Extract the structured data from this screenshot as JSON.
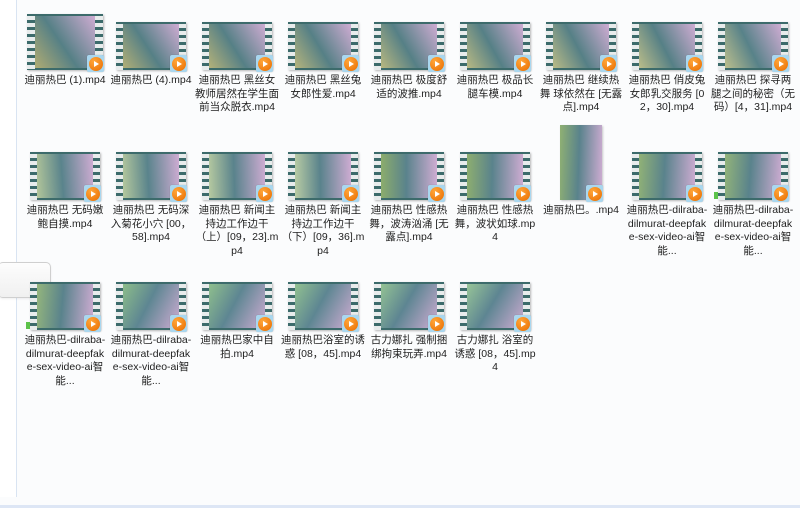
{
  "window": {
    "background_color": "#fbfcfd",
    "border_color": "#dde6f5",
    "view_mode": "Large icons thumbnail grid"
  },
  "left_rail": {
    "handle_label": ""
  },
  "icons": {
    "play_badge": "play-icon",
    "overlay_badge": "video-overlay-icon"
  },
  "colors": {
    "filmstrip": "#3c6b6b",
    "play_badge_bg": "#a9d7ef",
    "play_disc": "#f07d10",
    "label_text": "#1f1f1f",
    "sync_dot": "#5cc24a"
  },
  "grid": {
    "columns": 9,
    "rows": 3,
    "total_items": 24,
    "items": [
      {
        "name": "迪丽热巴 (1).mp4",
        "type": "video",
        "thumb_style": "filmstrip-large",
        "row": 1,
        "col": 1,
        "img": "thumb-01"
      },
      {
        "name": "迪丽热巴 (4).mp4",
        "type": "video",
        "thumb_style": "filmstrip",
        "row": 1,
        "col": 2,
        "img": "thumb-02"
      },
      {
        "name": "迪丽热巴 黑丝女教师居然在学生面前当众脱衣.mp4",
        "type": "video",
        "thumb_style": "filmstrip",
        "row": 1,
        "col": 3,
        "img": "thumb-03"
      },
      {
        "name": "迪丽热巴 黑丝兔女郎性爱.mp4",
        "type": "video",
        "thumb_style": "filmstrip",
        "row": 1,
        "col": 4,
        "img": "thumb-04"
      },
      {
        "name": "迪丽热巴 极度舒适的波推.mp4",
        "type": "video",
        "thumb_style": "filmstrip",
        "row": 1,
        "col": 5,
        "img": "thumb-05"
      },
      {
        "name": "迪丽热巴 极品长腿车模.mp4",
        "type": "video",
        "thumb_style": "filmstrip",
        "row": 1,
        "col": 6,
        "img": "thumb-06"
      },
      {
        "name": "迪丽热巴 继续热舞 球依然在 [无露点].mp4",
        "type": "video",
        "thumb_style": "filmstrip",
        "row": 1,
        "col": 7,
        "img": "thumb-07"
      },
      {
        "name": "迪丽热巴 俏皮兔女郎乳交服务 [02，30].mp4",
        "type": "video",
        "thumb_style": "filmstrip",
        "row": 1,
        "col": 8,
        "img": "thumb-08"
      },
      {
        "name": "迪丽热巴 探寻两腿之间的秘密（无码）[4，31].mp4",
        "type": "video",
        "thumb_style": "filmstrip",
        "row": 1,
        "col": 9,
        "img": "thumb-09"
      },
      {
        "name": "迪丽热巴 无码嫩鲍自摸.mp4",
        "type": "video",
        "thumb_style": "filmstrip",
        "row": 2,
        "col": 1,
        "img": "thumb-10"
      },
      {
        "name": "迪丽热巴 无码深入菊花小穴 [00，58].mp4",
        "type": "video",
        "thumb_style": "filmstrip",
        "row": 2,
        "col": 2,
        "img": "thumb-11"
      },
      {
        "name": "迪丽热巴 新闻主持边工作边干（上）[09，23].mp4",
        "type": "video",
        "thumb_style": "filmstrip",
        "row": 2,
        "col": 3,
        "img": "thumb-12"
      },
      {
        "name": "迪丽热巴 新闻主持边工作边干（下）[09，36].mp4",
        "type": "video",
        "thumb_style": "filmstrip",
        "row": 2,
        "col": 4,
        "img": "thumb-13"
      },
      {
        "name": "迪丽热巴 性感热舞，波涛汹涌 [无露点].mp4",
        "type": "video",
        "thumb_style": "filmstrip",
        "row": 2,
        "col": 5,
        "img": "thumb-14"
      },
      {
        "name": "迪丽热巴 性感热舞，波状如球.mp4",
        "type": "video",
        "thumb_style": "filmstrip",
        "row": 2,
        "col": 6,
        "img": "thumb-15"
      },
      {
        "name": "迪丽热巴。.mp4",
        "type": "video",
        "thumb_style": "portrait",
        "row": 2,
        "col": 7,
        "img": "thumb-16"
      },
      {
        "name": "迪丽热巴-dilraba-dilmurat-deepfake-sex-video-ai智能...",
        "type": "video",
        "thumb_style": "filmstrip",
        "row": 2,
        "col": 8,
        "img": "thumb-17"
      },
      {
        "name": "迪丽热巴-dilraba-dilmurat-deepfake-sex-video-ai智能...",
        "type": "video",
        "thumb_style": "filmstrip",
        "row": 2,
        "col": 9,
        "img": "thumb-18",
        "sync_badge": true
      },
      {
        "name": "迪丽热巴-dilraba-dilmurat-deepfake-sex-video-ai智能...",
        "type": "video",
        "thumb_style": "filmstrip",
        "row": 3,
        "col": 1,
        "img": "thumb-19",
        "sync_badge": true
      },
      {
        "name": "迪丽热巴-dilraba-dilmurat-deepfake-sex-video-ai智能...",
        "type": "video",
        "thumb_style": "filmstrip",
        "row": 3,
        "col": 2,
        "img": "thumb-20"
      },
      {
        "name": "迪丽热巴家中自拍.mp4",
        "type": "video",
        "thumb_style": "filmstrip",
        "row": 3,
        "col": 3,
        "img": "thumb-21"
      },
      {
        "name": "迪丽热巴浴室的诱惑 [08，45].mp4",
        "type": "video",
        "thumb_style": "filmstrip",
        "row": 3,
        "col": 4,
        "img": "thumb-22"
      },
      {
        "name": "古力娜扎 强制捆绑拘束玩弄.mp4",
        "type": "video",
        "thumb_style": "filmstrip",
        "row": 3,
        "col": 5,
        "img": "thumb-23"
      },
      {
        "name": "古力娜扎 浴室的诱惑 [08，45].mp4",
        "type": "video",
        "thumb_style": "filmstrip",
        "row": 3,
        "col": 6,
        "img": "thumb-24"
      }
    ]
  }
}
